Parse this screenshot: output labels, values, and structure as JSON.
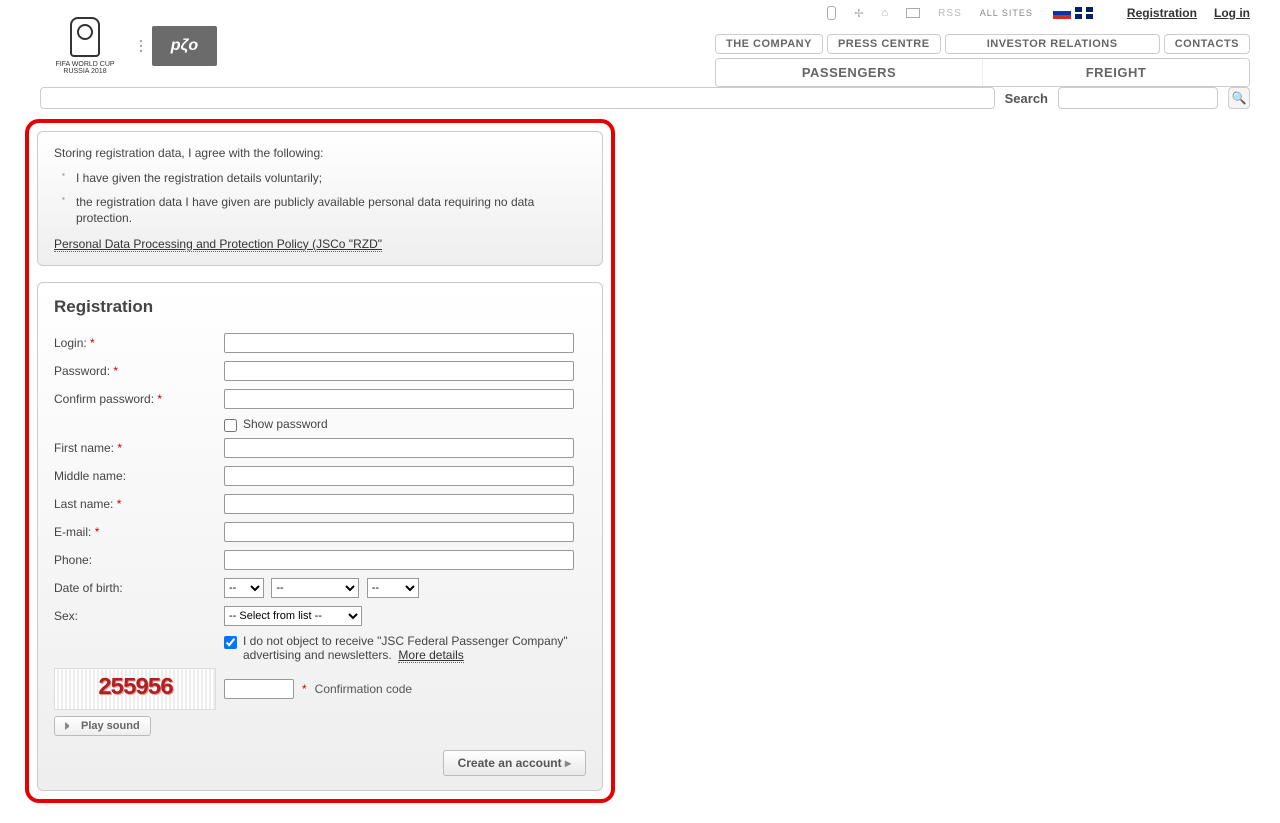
{
  "header": {
    "fifa_line1": "FIFA WORLD CUP",
    "fifa_line2": "RUSSIA 2018",
    "rzd_logo": "рζо",
    "rss": "RSS",
    "all_sites": "ALL SITES",
    "auth": {
      "registration": "Registration",
      "login": "Log in"
    },
    "nav1": {
      "company": "THE COMPANY",
      "press": "PRESS CENTRE",
      "investor": "INVESTOR RELATIONS",
      "contacts": "CONTACTS"
    },
    "nav2": {
      "passengers": "PASSENGERS",
      "freight": "FREIGHT"
    },
    "search_label": "Search"
  },
  "agree": {
    "intro": "Storing registration data, I agree with the following:",
    "item1": "I have given the registration details voluntarily;",
    "item2": "the registration data I have given are publicly available personal data requiring no data protection.",
    "policy": "Personal Data Processing and Protection Policy (JSCo \"RZD\""
  },
  "reg": {
    "title": "Registration",
    "login": "Login:",
    "password": "Password:",
    "confirm": "Confirm password:",
    "show_pw": "Show password",
    "first": "First name:",
    "middle": "Middle name:",
    "last": "Last name:",
    "email": "E-mail:",
    "phone": "Phone:",
    "dob": "Date of birth:",
    "sex": "Sex:",
    "sel_placeholder": "--",
    "sex_placeholder": "-- Select from list --",
    "consent_text": "I do not object to receive \"JSC Federal Passenger Company\" advertising and newsletters.",
    "more": "More details",
    "captcha_value": "255956",
    "captcha_label": "Confirmation code",
    "play_sound": "Play sound",
    "create": "Create an account"
  }
}
